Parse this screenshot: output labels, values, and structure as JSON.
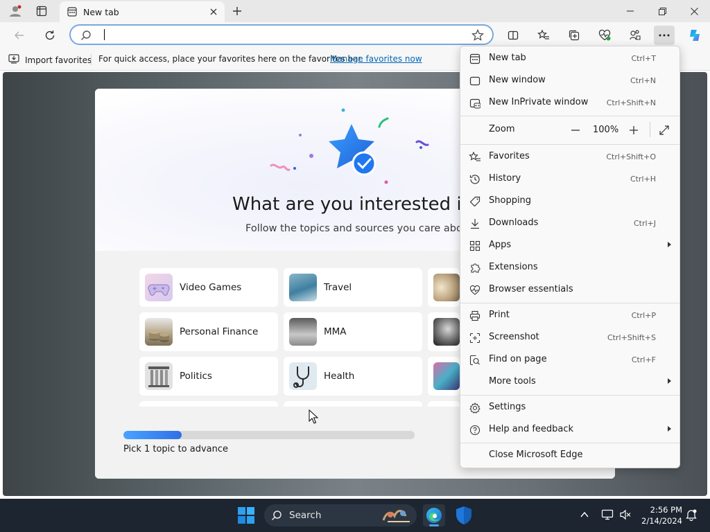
{
  "tab": {
    "title": "New tab"
  },
  "address": {
    "value": "",
    "placeholder": ""
  },
  "favorites_bar": {
    "import_label": "Import favorites",
    "hint": "For quick access, place your favorites here on the favorites bar.",
    "manage_link": "Manage favorites now"
  },
  "onboarding": {
    "title": "What are you interested in?",
    "subtitle": "Follow the topics and sources you care about",
    "topics": [
      {
        "label": "Video Games"
      },
      {
        "label": "Travel"
      },
      {
        "label": "Personal Finance"
      },
      {
        "label": "MMA"
      },
      {
        "label": "Politics"
      },
      {
        "label": "Health"
      }
    ],
    "progress_fraction": 0.2,
    "progress_label": "Pick 1 topic to advance"
  },
  "menu": {
    "items": [
      {
        "label": "New tab",
        "shortcut": "Ctrl+T"
      },
      {
        "label": "New window",
        "shortcut": "Ctrl+N"
      },
      {
        "label": "New InPrivate window",
        "shortcut": "Ctrl+Shift+N"
      },
      {
        "label": "Zoom",
        "value": "100%"
      },
      {
        "label": "Favorites",
        "shortcut": "Ctrl+Shift+O"
      },
      {
        "label": "History",
        "shortcut": "Ctrl+H"
      },
      {
        "label": "Shopping",
        "shortcut": ""
      },
      {
        "label": "Downloads",
        "shortcut": "Ctrl+J"
      },
      {
        "label": "Apps",
        "shortcut": ""
      },
      {
        "label": "Extensions",
        "shortcut": ""
      },
      {
        "label": "Browser essentials",
        "shortcut": ""
      },
      {
        "label": "Print",
        "shortcut": "Ctrl+P"
      },
      {
        "label": "Screenshot",
        "shortcut": "Ctrl+Shift+S"
      },
      {
        "label": "Find on page",
        "shortcut": "Ctrl+F"
      },
      {
        "label": "More tools",
        "shortcut": ""
      },
      {
        "label": "Settings",
        "shortcut": ""
      },
      {
        "label": "Help and feedback",
        "shortcut": ""
      },
      {
        "label": "Close Microsoft Edge",
        "shortcut": ""
      }
    ]
  },
  "taskbar": {
    "search_label": "Search",
    "time": "2:56 PM",
    "date": "2/14/2024"
  },
  "colors": {
    "accent": "#0066b4",
    "taskbar": "#1c2530",
    "progress": "#3a86f0"
  }
}
